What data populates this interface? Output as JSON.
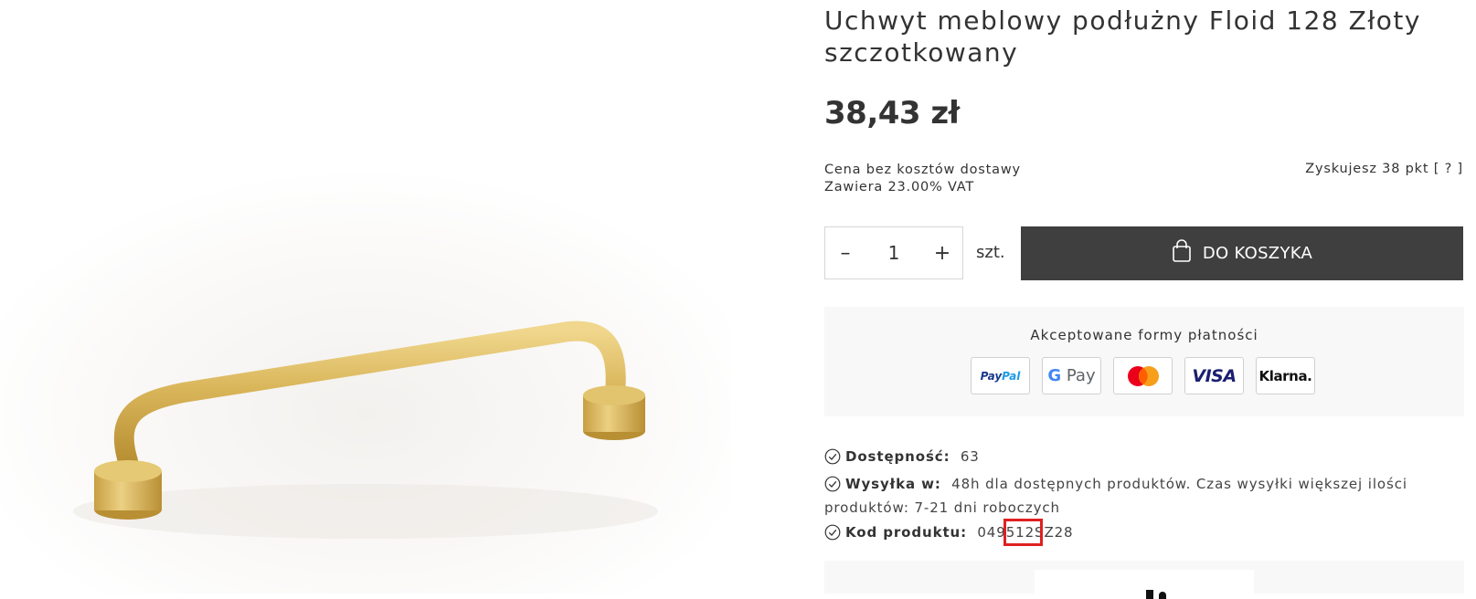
{
  "product": {
    "title": "Uchwyt meblowy podłużny Floid 128 Złoty szczotkowany",
    "price": "38,43 zł",
    "price_note_1": "Cena bez kosztów dostawy",
    "price_note_2": "Zawiera 23.00% VAT",
    "points_text": "Zyskujesz 38 pkt",
    "points_help": "[ ? ]"
  },
  "cart": {
    "quantity": "1",
    "decrement_symbol": "–",
    "increment_symbol": "+",
    "unit": "szt.",
    "add_to_cart_label": "DO KOSZYKA"
  },
  "payments": {
    "label": "Akceptowane formy płatności",
    "methods": [
      "PayPal",
      "G Pay",
      "Mastercard",
      "VISA",
      "Klarna."
    ]
  },
  "info": {
    "availability_label": "Dostępność:",
    "availability_value": "63",
    "shipping_label": "Wysyłka w:",
    "shipping_value": "48h dla dostępnych produktów. Czas wysyłki większej ilości produktów: 7-21 dni roboczych",
    "code_label": "Kod produktu:",
    "code_value": "049512SZ28"
  },
  "colors": {
    "cart_button": "#3f3f3f",
    "panel_bg": "#f8f8f8",
    "highlight": "#e02020",
    "handle_gold": "#d9b559"
  },
  "icons": [
    "minus-icon",
    "plus-icon",
    "shopping-bag-icon",
    "check-circle-icon"
  ]
}
